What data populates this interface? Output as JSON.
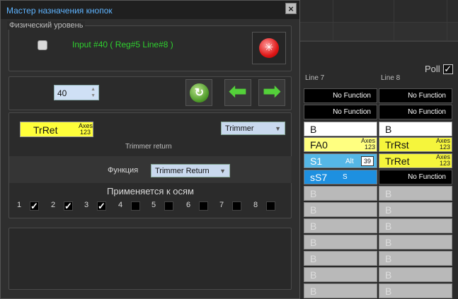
{
  "dialog": {
    "title": "Мастер назначения кнопок",
    "close_label": "×",
    "physical_group_label": "Физический уровень",
    "input_label": "Input #40  ( Reg#5  Line#8 )",
    "spin_value": "40",
    "assign_chip": {
      "main": "TrRet",
      "axes": "Axes",
      "nums": "123"
    },
    "type_select": "Trimmer",
    "type_caption": "Trimmer return",
    "function_label": "Функция",
    "function_select": "Trimmer Return",
    "axes_title": "Применяется к осям",
    "axes": [
      {
        "num": "1",
        "checked": true
      },
      {
        "num": "2",
        "checked": true
      },
      {
        "num": "3",
        "checked": true
      },
      {
        "num": "4",
        "checked": false
      },
      {
        "num": "5",
        "checked": false
      },
      {
        "num": "6",
        "checked": false
      },
      {
        "num": "7",
        "checked": false
      },
      {
        "num": "8",
        "checked": false
      }
    ]
  },
  "panel": {
    "poll_label": "Poll",
    "poll_checked": true,
    "columns": [
      "Line 7",
      "Line 8"
    ],
    "line7": [
      {
        "type": "black",
        "text": "No Function"
      },
      {
        "type": "black",
        "text": "No Function"
      },
      {
        "type": "white",
        "text": "B"
      },
      {
        "type": "yellow",
        "text": "FA0",
        "axes": "Axes",
        "nums": "123"
      },
      {
        "type": "cyan",
        "text": "S1",
        "alt": "Alt",
        "num": "39"
      },
      {
        "type": "blue",
        "text": "sS7",
        "s": "S"
      },
      {
        "type": "gray",
        "text": "B"
      },
      {
        "type": "gray",
        "text": "B"
      },
      {
        "type": "gray",
        "text": "B"
      },
      {
        "type": "gray",
        "text": "B"
      },
      {
        "type": "gray",
        "text": "B"
      },
      {
        "type": "gray",
        "text": "B"
      },
      {
        "type": "gray",
        "text": "B"
      }
    ],
    "line8": [
      {
        "type": "black",
        "text": "No Function"
      },
      {
        "type": "black",
        "text": "No Function"
      },
      {
        "type": "white",
        "text": "B"
      },
      {
        "type": "yellow2",
        "text": "TrRst",
        "axes": "Axes",
        "nums": "123"
      },
      {
        "type": "yellow2",
        "text": "TrRet",
        "axes": "Axes",
        "nums": "123"
      },
      {
        "type": "black",
        "text": "No Function"
      },
      {
        "type": "gray",
        "text": "B"
      },
      {
        "type": "gray",
        "text": "B"
      },
      {
        "type": "gray",
        "text": "B"
      },
      {
        "type": "gray",
        "text": "B"
      },
      {
        "type": "gray",
        "text": "B"
      },
      {
        "type": "gray",
        "text": "B"
      },
      {
        "type": "gray",
        "text": "B"
      }
    ]
  },
  "colors": {
    "title": "#5fb4ff",
    "input_text": "#2fd02f",
    "chip": "#ffff3a",
    "arrow": "#54d13a"
  }
}
